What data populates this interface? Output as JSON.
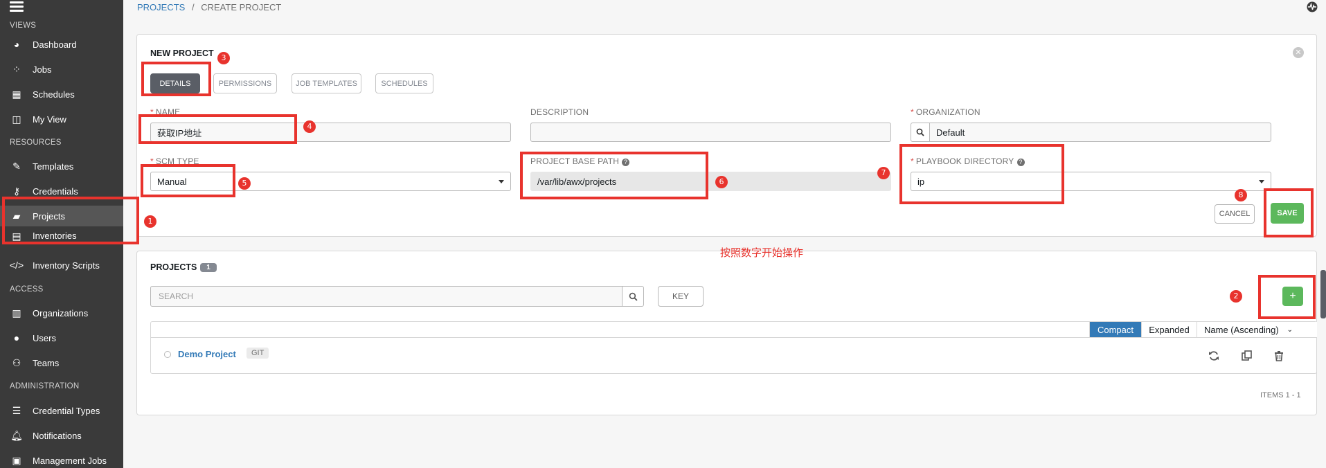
{
  "sidebar": {
    "sections": [
      "VIEWS",
      "RESOURCES",
      "ACCESS",
      "ADMINISTRATION"
    ],
    "items": [
      {
        "label": "Dashboard",
        "icon": "dashboard-icon"
      },
      {
        "label": "Jobs",
        "icon": "jobs-icon"
      },
      {
        "label": "Schedules",
        "icon": "calendar-icon"
      },
      {
        "label": "My View",
        "icon": "my-view-icon"
      },
      {
        "label": "Templates",
        "icon": "pencil-icon"
      },
      {
        "label": "Credentials",
        "icon": "key-icon"
      },
      {
        "label": "Projects",
        "icon": "folder-icon",
        "active": true
      },
      {
        "label": "Inventories",
        "icon": "inventory-icon"
      },
      {
        "label": "Inventory Scripts",
        "icon": "code-icon"
      },
      {
        "label": "Organizations",
        "icon": "building-icon"
      },
      {
        "label": "Users",
        "icon": "user-icon"
      },
      {
        "label": "Teams",
        "icon": "team-icon"
      },
      {
        "label": "Credential Types",
        "icon": "list-icon"
      },
      {
        "label": "Notifications",
        "icon": "bell-icon"
      },
      {
        "label": "Management Jobs",
        "icon": "briefcase-icon"
      }
    ]
  },
  "breadcrumb": {
    "projects": "PROJECTS",
    "sep": "/",
    "current": "CREATE PROJECT"
  },
  "form": {
    "title": "NEW PROJECT",
    "tabs": [
      "DETAILS",
      "PERMISSIONS",
      "JOB TEMPLATES",
      "SCHEDULES"
    ],
    "name_label": "NAME",
    "name_value": "获取IP地址",
    "description_label": "DESCRIPTION",
    "description_value": "",
    "organization_label": "ORGANIZATION",
    "organization_value": "Default",
    "scm_type_label": "SCM TYPE",
    "scm_type_value": "Manual",
    "base_path_label": "PROJECT BASE PATH",
    "base_path_value": "/var/lib/awx/projects",
    "playbook_dir_label": "PLAYBOOK DIRECTORY",
    "playbook_dir_value": "ip",
    "cancel": "CANCEL",
    "save": "SAVE",
    "required_mark": "*"
  },
  "annotations": {
    "numbers": [
      "1",
      "2",
      "3",
      "4",
      "5",
      "6",
      "7",
      "8"
    ],
    "note": "按照数字开始操作",
    "color": "#e8332d"
  },
  "projects_list": {
    "title": "PROJECTS",
    "count": "1",
    "search_placeholder": "SEARCH",
    "key": "KEY",
    "add": "+",
    "view_toggle": [
      "Compact",
      "Expanded"
    ],
    "sort": "Name (Ascending)",
    "rows": [
      {
        "name": "Demo Project",
        "tag": "GIT"
      }
    ],
    "items_label": "ITEMS  1 - 1"
  },
  "colors": {
    "sidebar": "#3a3a3a",
    "link": "#337ab7",
    "success": "#5cb85c",
    "danger": "#d9534f"
  }
}
